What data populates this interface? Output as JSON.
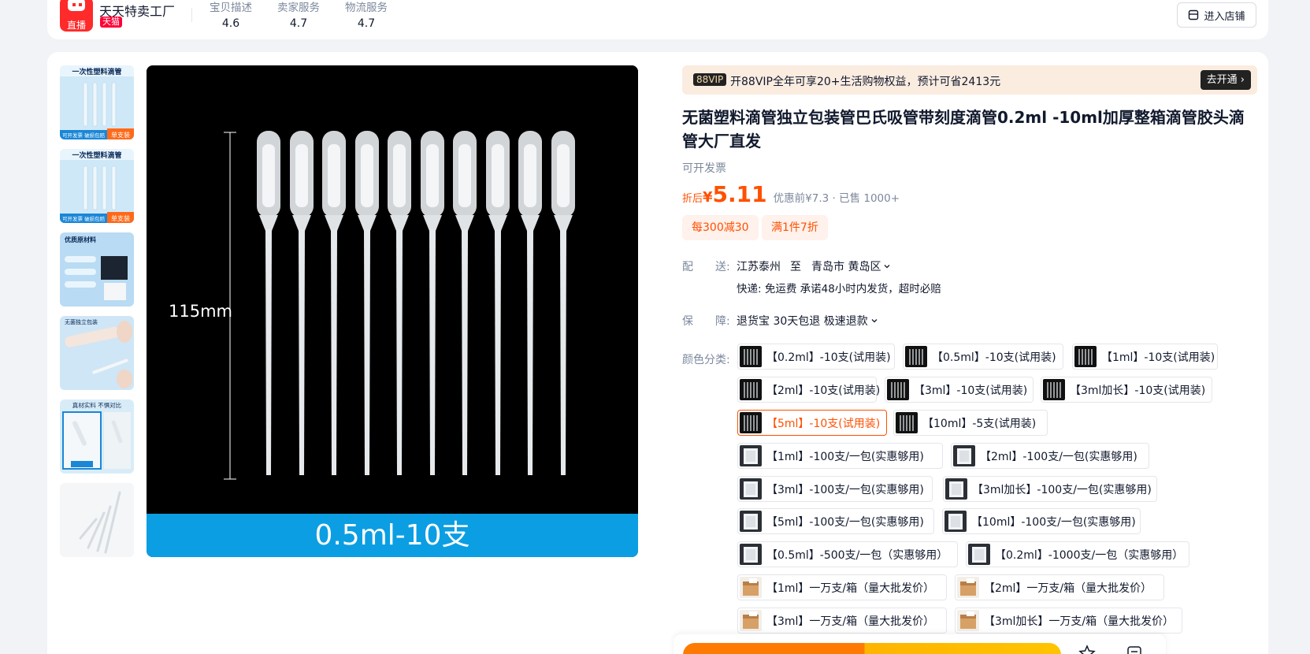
{
  "store": {
    "name": "天天特卖工厂",
    "badge": "天猫",
    "logo_text": "直播",
    "ratings": [
      {
        "label": "宝贝描述",
        "value": "4.6"
      },
      {
        "label": "卖家服务",
        "value": "4.7"
      },
      {
        "label": "物流服务",
        "value": "4.7"
      }
    ],
    "enter_shop": "进入店铺"
  },
  "gallery": {
    "main_caption": "0.5ml-10支",
    "dimension_label": "115mm",
    "thumbnails": [
      {
        "title": "一次性塑料滴管",
        "tag": "单支装",
        "foot": "可开发票 破损包赔"
      },
      {
        "title": "一次性塑料滴管",
        "tag": "单支装",
        "foot": "可开发票 破损包赔"
      },
      {
        "title": "优质原材料"
      },
      {
        "title": "无菌独立包装"
      },
      {
        "title": "真材实料 不惧对比"
      },
      {
        "title": ""
      }
    ]
  },
  "vip": {
    "tag": "88VIP",
    "text": "开88VIP全年可享20+生活购物权益，预计可省2413元",
    "button": "去开通 ›"
  },
  "product": {
    "title": "无菌塑料滴管独立包装管巴氏吸管带刻度滴管0.2ml -10ml加厚整箱滴管胶头滴管大厂直发",
    "invoice": "可开发票",
    "price_prefix": "折后",
    "price_currency": "¥",
    "price": "5.11",
    "price_meta": "优惠前¥7.3 · 已售 1000+",
    "coupons": [
      "每300减30",
      "满1件7折"
    ]
  },
  "delivery": {
    "label": "配　　送:",
    "from": "江苏泰州",
    "to_word": "至",
    "to": "青岛市 黄岛区",
    "detail": "快递: 免运费  承诺48小时内发货，超时必赔"
  },
  "guarantee": {
    "label": "保　　障:",
    "text": "退货宝 30天包退 极速退款"
  },
  "sku": {
    "label": "颜色分类:",
    "selected": "【5ml】-10支(试用装)",
    "options": [
      "【0.2ml】-10支(试用装)",
      "【0.5ml】-10支(试用装)",
      "【1ml】-10支(试用装)",
      "【2ml】-10支(试用装)",
      "【3ml】-10支(试用装)",
      "【3ml加长】-10支(试用装)",
      "【5ml】-10支(试用装)",
      "【10ml】-5支(试用装)",
      "【1ml】-100支/一包(实惠够用)",
      "【2ml】-100支/一包(实惠够用)",
      "【3ml】-100支/一包(实惠够用)",
      "【3ml加长】-100支/一包(实惠够用)",
      "【5ml】-100支/一包(实惠够用)",
      "【10ml】-100支/一包(实惠够用)",
      "【0.5ml】-500支/一包（实惠够用）",
      "【0.2ml】-1000支/一包（实惠够用）",
      "【1ml】一万支/箱（量大批发价）",
      "【2ml】一万支/箱（量大批发价）",
      "【3ml】一万支/箱（量大批发价）",
      "【3ml加长】一万支/箱（量大批发价）"
    ]
  },
  "colors": {
    "accent": "#ff5000",
    "brand_red": "#ff0036",
    "caption_blue": "#0b9ee3"
  }
}
